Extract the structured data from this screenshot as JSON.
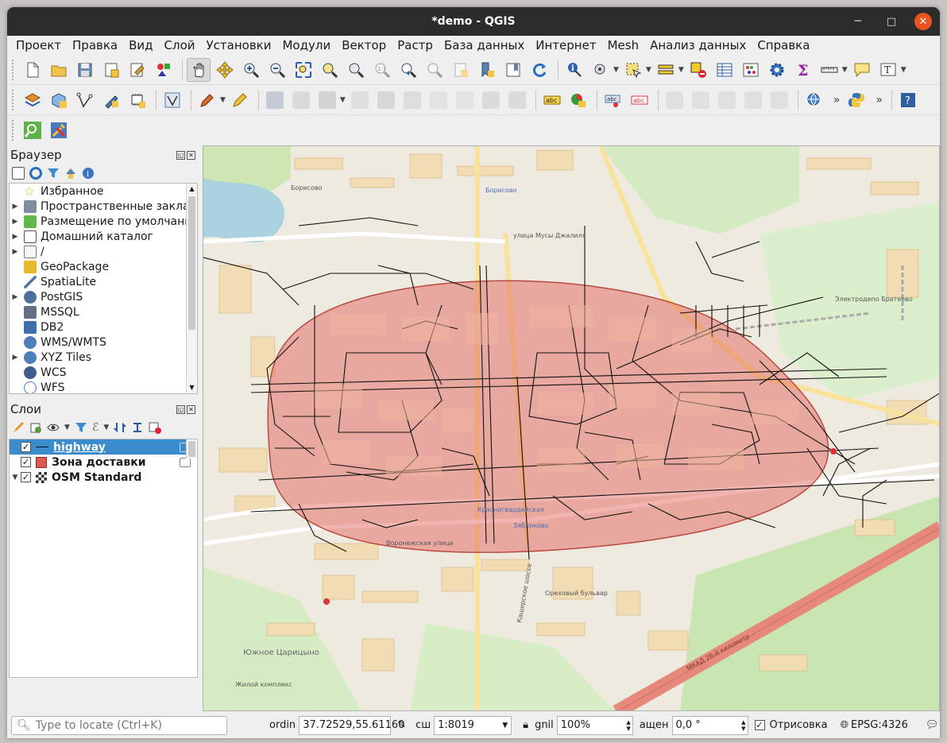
{
  "window": {
    "title": "*demo - QGIS",
    "minimize_glyph": "─",
    "maximize_glyph": "□",
    "close_glyph": "✕"
  },
  "menu": [
    {
      "label": "Проект"
    },
    {
      "label": "Правка"
    },
    {
      "label": "Вид"
    },
    {
      "label": "Слой"
    },
    {
      "label": "Установки"
    },
    {
      "label": "Модули"
    },
    {
      "label": "Вектор"
    },
    {
      "label": "Растр"
    },
    {
      "label": "База данных"
    },
    {
      "label": "Интернет"
    },
    {
      "label": "Mesh"
    },
    {
      "label": "Анализ данных"
    },
    {
      "label": "Справка"
    }
  ],
  "toolbar_overflow_glyph": "»",
  "browser_panel": {
    "title": "Браузер",
    "items": [
      {
        "label": "Избранное",
        "icon": "star-icon",
        "expandable": false
      },
      {
        "label": "Пространственные закла",
        "icon": "bookmark-icon",
        "expandable": true
      },
      {
        "label": "Размещение по умолчани",
        "icon": "project-home-icon",
        "expandable": true
      },
      {
        "label": "Домашний каталог",
        "icon": "home-icon",
        "expandable": true
      },
      {
        "label": "/",
        "icon": "folder-icon",
        "expandable": true
      },
      {
        "label": "GeoPackage",
        "icon": "geopackage-icon",
        "expandable": false
      },
      {
        "label": "SpatiaLite",
        "icon": "spatialite-icon",
        "expandable": false
      },
      {
        "label": "PostGIS",
        "icon": "postgis-icon",
        "expandable": true
      },
      {
        "label": "MSSQL",
        "icon": "mssql-icon",
        "expandable": false
      },
      {
        "label": "DB2",
        "icon": "db2-icon",
        "expandable": false
      },
      {
        "label": "WMS/WMTS",
        "icon": "globe-icon",
        "expandable": false
      },
      {
        "label": "XYZ Tiles",
        "icon": "xyz-tiles-icon",
        "expandable": true
      },
      {
        "label": "WCS",
        "icon": "wcs-icon",
        "expandable": false
      },
      {
        "label": "WFS",
        "icon": "wfs-icon",
        "expandable": false
      }
    ]
  },
  "layers_panel": {
    "title": "Слои",
    "layers": [
      {
        "name": "highway",
        "checked": true,
        "selected": true,
        "icon": "line-layer-icon"
      },
      {
        "name": "Зона доставки",
        "checked": true,
        "selected": false,
        "icon": "polygon-layer-icon"
      },
      {
        "name": "OSM Standard",
        "checked": true,
        "selected": false,
        "icon": "raster-tile-icon"
      }
    ]
  },
  "map_labels": {
    "borisovo_left": "Борисово",
    "borisovo_top": "Борисово",
    "musa_jalilya": "улица Мусы Джалиля",
    "brateevo_station": "Электродепо Братеево",
    "orekhovo": "Ореховый бульвар",
    "krasnogvardeyskaya": "Красногвардейская",
    "zyablikovo": "Зябликово",
    "vosourg": "Воронежская улица",
    "kashirskoe": "Каширское шоссе",
    "mkad": "МКАД 26-й километр",
    "yuzhnoe_tsaritsyno": "Южное Царицыно",
    "zhk": "Жилой комплекс"
  },
  "status": {
    "locate_placeholder": "Type to locate (Ctrl+K)",
    "coord_label": "ordin",
    "coord_value": "37.72529,55.61160",
    "scale_label": "сш",
    "scale_value": "1:8019",
    "magnifier_label": "gnil",
    "magnifier_value": "100%",
    "rotation_label": "ащен",
    "rotation_value": "0,0 °",
    "render_label": "Отрисовка",
    "render_checked": true,
    "crs_value": "EPSG:4326"
  },
  "colors": {
    "titlebar": "#2c2c2c",
    "close_button": "#e95420",
    "selection": "#3a8ccd",
    "delivery_zone": "#e0594f"
  }
}
